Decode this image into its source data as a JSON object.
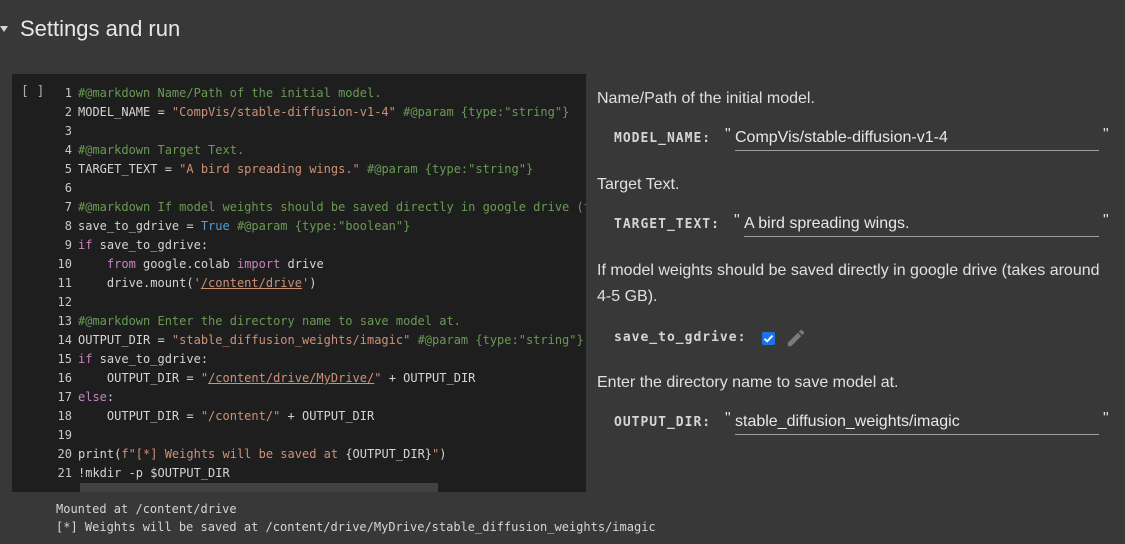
{
  "section": {
    "title": "Settings and run"
  },
  "cell": {
    "run_indicator": "[ ]",
    "lines": [
      {
        "n": "1",
        "segs": [
          {
            "t": "#@markdown Name/Path of the initial model.",
            "c": "c-comment"
          }
        ]
      },
      {
        "n": "2",
        "segs": [
          {
            "t": "MODEL_NAME = ",
            "c": "c-txt"
          },
          {
            "t": "\"CompVis/stable-diffusion-v1-4\"",
            "c": "c-str"
          },
          {
            "t": " #@param {type:\"string\"}",
            "c": "c-comment"
          }
        ]
      },
      {
        "n": "3",
        "segs": []
      },
      {
        "n": "4",
        "segs": [
          {
            "t": "#@markdown Target Text.",
            "c": "c-comment"
          }
        ]
      },
      {
        "n": "5",
        "segs": [
          {
            "t": "TARGET_TEXT = ",
            "c": "c-txt"
          },
          {
            "t": "\"A bird spreading wings.\"",
            "c": "c-str"
          },
          {
            "t": " #@param {type:\"string\"}",
            "c": "c-comment"
          }
        ]
      },
      {
        "n": "6",
        "segs": []
      },
      {
        "n": "7",
        "segs": [
          {
            "t": "#@markdown If model weights should be saved directly in google drive (ta",
            "c": "c-comment"
          }
        ]
      },
      {
        "n": "8",
        "segs": [
          {
            "t": "save_to_gdrive = ",
            "c": "c-txt"
          },
          {
            "t": "True",
            "c": "c-const"
          },
          {
            "t": " #@param {type:\"boolean\"}",
            "c": "c-comment"
          }
        ]
      },
      {
        "n": "9",
        "segs": [
          {
            "t": "if",
            "c": "c-kw"
          },
          {
            "t": " save_to_gdrive:",
            "c": "c-txt"
          }
        ]
      },
      {
        "n": "10",
        "segs": [
          {
            "t": "    ",
            "c": "c-txt"
          },
          {
            "t": "from",
            "c": "c-kw"
          },
          {
            "t": " google.colab ",
            "c": "c-txt"
          },
          {
            "t": "import",
            "c": "c-kw"
          },
          {
            "t": " drive",
            "c": "c-txt"
          }
        ]
      },
      {
        "n": "11",
        "segs": [
          {
            "t": "    drive.mount(",
            "c": "c-txt"
          },
          {
            "t": "'",
            "c": "c-str"
          },
          {
            "t": "/content/drive",
            "c": "c-link"
          },
          {
            "t": "'",
            "c": "c-str"
          },
          {
            "t": ")",
            "c": "c-txt"
          }
        ]
      },
      {
        "n": "12",
        "segs": []
      },
      {
        "n": "13",
        "segs": [
          {
            "t": "#@markdown Enter the directory name to save model at.",
            "c": "c-comment"
          }
        ]
      },
      {
        "n": "14",
        "segs": [
          {
            "t": "OUTPUT_DIR = ",
            "c": "c-txt"
          },
          {
            "t": "\"stable_diffusion_weights/imagic\"",
            "c": "c-str"
          },
          {
            "t": " #@param {type:\"string\"}",
            "c": "c-comment"
          }
        ]
      },
      {
        "n": "15",
        "segs": [
          {
            "t": "if",
            "c": "c-kw"
          },
          {
            "t": " save_to_gdrive:",
            "c": "c-txt"
          }
        ]
      },
      {
        "n": "16",
        "segs": [
          {
            "t": "    OUTPUT_DIR = ",
            "c": "c-txt"
          },
          {
            "t": "\"",
            "c": "c-str"
          },
          {
            "t": "/content/drive/MyDrive/",
            "c": "c-link"
          },
          {
            "t": "\"",
            "c": "c-str"
          },
          {
            "t": " + OUTPUT_DIR",
            "c": "c-txt"
          }
        ]
      },
      {
        "n": "17",
        "segs": [
          {
            "t": "else",
            "c": "c-kw"
          },
          {
            "t": ":",
            "c": "c-txt"
          }
        ]
      },
      {
        "n": "18",
        "segs": [
          {
            "t": "    OUTPUT_DIR = ",
            "c": "c-txt"
          },
          {
            "t": "\"/content/\"",
            "c": "c-str"
          },
          {
            "t": " + OUTPUT_DIR",
            "c": "c-txt"
          }
        ]
      },
      {
        "n": "19",
        "segs": []
      },
      {
        "n": "20",
        "segs": [
          {
            "t": "print",
            "c": "c-txt"
          },
          {
            "t": "(",
            "c": "c-txt"
          },
          {
            "t": "f\"[*] Weights will be saved at ",
            "c": "c-str"
          },
          {
            "t": "{OUTPUT_DIR}",
            "c": "c-txt"
          },
          {
            "t": "\"",
            "c": "c-str"
          },
          {
            "t": ")",
            "c": "c-txt"
          }
        ]
      },
      {
        "n": "21",
        "segs": [
          {
            "t": "!mkdir -p $OUTPUT_DIR",
            "c": "c-txt"
          }
        ]
      }
    ]
  },
  "output": {
    "line1": "Mounted at /content/drive",
    "line2": "[*] Weights will be saved at /content/drive/MyDrive/stable_diffusion_weights/imagic"
  },
  "form": {
    "model_desc": "Name/Path of the initial model.",
    "model_label": "MODEL_NAME:",
    "model_value": "CompVis/stable-diffusion-v1-4",
    "target_desc": "Target Text.",
    "target_label": "TARGET_TEXT:",
    "target_value": "A bird spreading wings.",
    "gdrive_desc": "If model weights should be saved directly in google drive (takes around 4-5 GB).",
    "gdrive_label": "save_to_gdrive:",
    "gdrive_checked": true,
    "output_desc": "Enter the directory name to save model at.",
    "output_label": "OUTPUT_DIR:",
    "output_value": "stable_diffusion_weights/imagic",
    "quote": "\""
  },
  "colors": {
    "accent": "#1a73e8",
    "cell_bg": "#1e1e1e",
    "page_bg": "#383838"
  }
}
